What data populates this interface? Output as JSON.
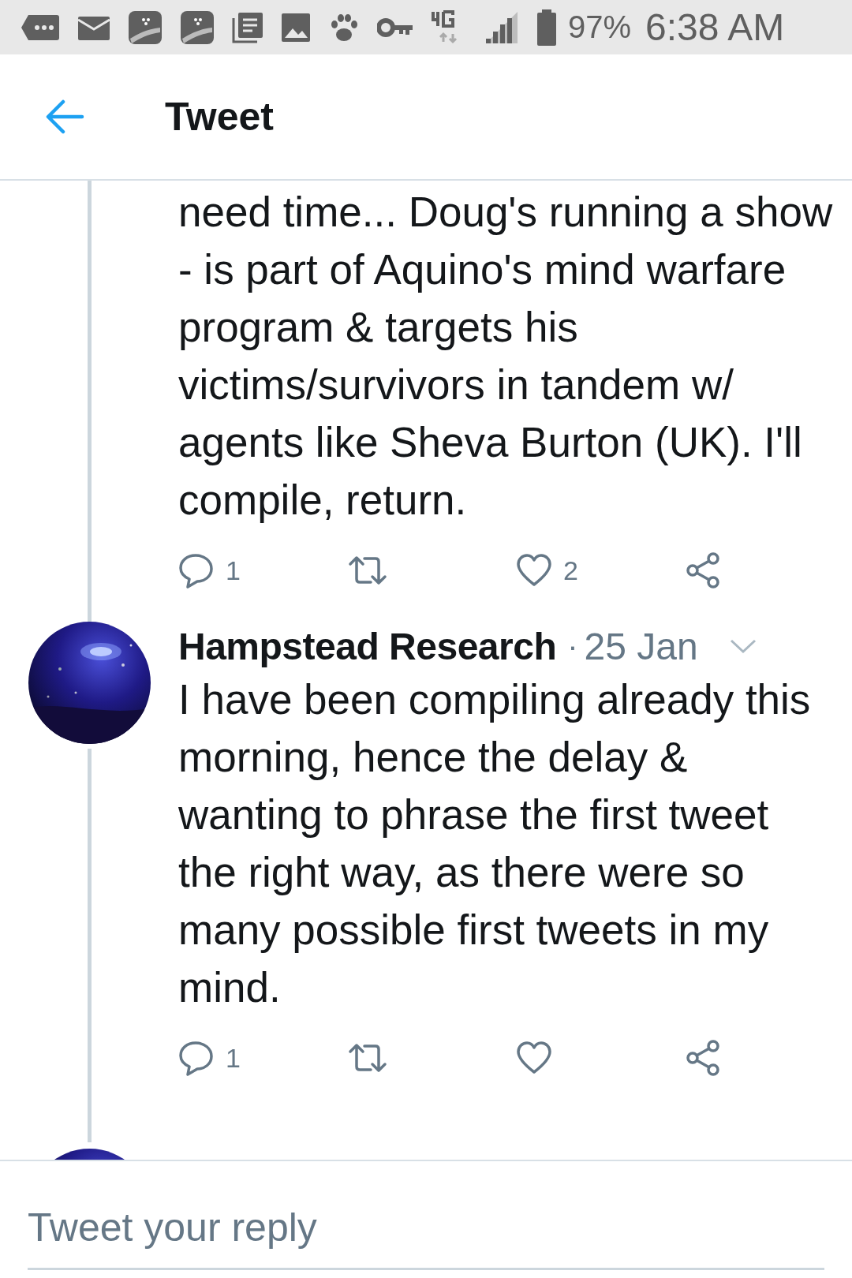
{
  "status_bar": {
    "battery": "97%",
    "time": "6:38 AM"
  },
  "header": {
    "title": "Tweet"
  },
  "tweets": [
    {
      "kind": "continued",
      "text": "need time... Doug's running a show - is part of Aquino's mind warfare program & targets his victims/survivors in tandem w/ agents like Sheva Burton (UK). I'll compile, return.",
      "actions": {
        "reply_count": "1",
        "like_count": "2"
      }
    },
    {
      "kind": "full",
      "author": "Hampstead Research",
      "separator": "·",
      "date": "25 Jan",
      "text": "I have been compiling already this morning, hence the delay & wanting to phrase the first tweet the right way, as there were so many possible first tweets in my mind.",
      "actions": {
        "reply_count": "1"
      }
    },
    {
      "kind": "peek"
    }
  ],
  "reply_bar": {
    "placeholder": "Tweet your reply"
  }
}
